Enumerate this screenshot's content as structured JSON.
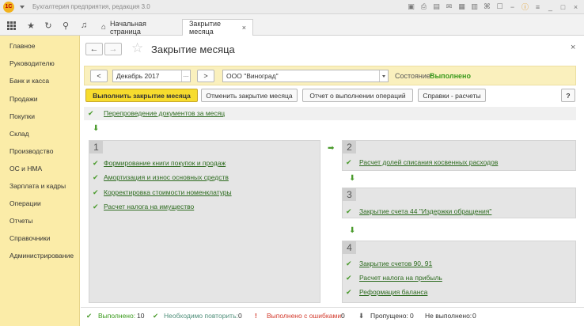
{
  "app": {
    "logo_text": "1С",
    "title": "Бухгалтерия предприятия, редакция 3.0",
    "titlebar_icons": [
      "save-icon",
      "print-icon",
      "preview-icon",
      "mail-icon",
      "calendar-icon",
      "calculator-icon",
      "link-icon",
      "bookmark-icon",
      "zoom-out-icon",
      "info-icon",
      "menu-icon",
      "minimize-icon",
      "restore-icon",
      "close-icon"
    ]
  },
  "toolbar": {
    "tabs": [
      {
        "label": "Начальная страница"
      },
      {
        "label": "Закрытие месяца",
        "close": "×"
      }
    ]
  },
  "sidebar": {
    "items": [
      {
        "label": "Главное"
      },
      {
        "label": "Руководителю"
      },
      {
        "label": "Банк и касса"
      },
      {
        "label": "Продажи"
      },
      {
        "label": "Покупки"
      },
      {
        "label": "Склад"
      },
      {
        "label": "Производство"
      },
      {
        "label": "ОС и НМА"
      },
      {
        "label": "Зарплата и кадры"
      },
      {
        "label": "Операции"
      },
      {
        "label": "Отчеты"
      },
      {
        "label": "Справочники"
      },
      {
        "label": "Администрирование"
      }
    ]
  },
  "page": {
    "title": "Закрытие месяца",
    "back": "←",
    "forward": "→",
    "close": "×"
  },
  "filter": {
    "prev": "<",
    "next": ">",
    "period": "Декабрь 2017",
    "period_dots": "...",
    "organization": "ООО \"Виноград\"",
    "state_label": "Состояние:",
    "state_value": "Выполнено"
  },
  "actions": {
    "run": "Выполнить закрытие месяца",
    "cancel": "Отменить закрытие месяца",
    "report": "Отчет о выполнении операций",
    "reference": "Справки - расчеты",
    "help": "?"
  },
  "repost": {
    "label": "Перепроведение документов за месяц"
  },
  "groups": [
    {
      "num": "1",
      "items": [
        "Формирование книги покупок и продаж",
        "Амортизация и износ основных средств",
        "Корректировка стоимости номенклатуры",
        "Расчет налога на имущество"
      ]
    },
    {
      "num": "2",
      "items": [
        "Расчет долей списания косвенных расходов"
      ]
    },
    {
      "num": "3",
      "items": [
        "Закрытие счета 44 \"Издержки обращения\""
      ]
    },
    {
      "num": "4",
      "items": [
        "Закрытие счетов 90, 91",
        "Расчет налога на прибыль",
        "Реформация баланса"
      ]
    }
  ],
  "status": {
    "done_label": "Выполнено:",
    "done_value": "10",
    "repeat_label": "Необходимо повторить:",
    "repeat_value": "0",
    "errors_label": "Выполнено с ошибками:",
    "errors_value": "0",
    "skipped_label": "Пропущено:",
    "skipped_value": "0",
    "notdone_label": "Не выполнено:",
    "notdone_value": "0"
  },
  "colors": {
    "sidebar_bg": "#fbeca8",
    "primary_button": "#f7dc2e",
    "success": "#3a9a1c",
    "error": "#d33a2c",
    "link": "#2d6b1f"
  }
}
